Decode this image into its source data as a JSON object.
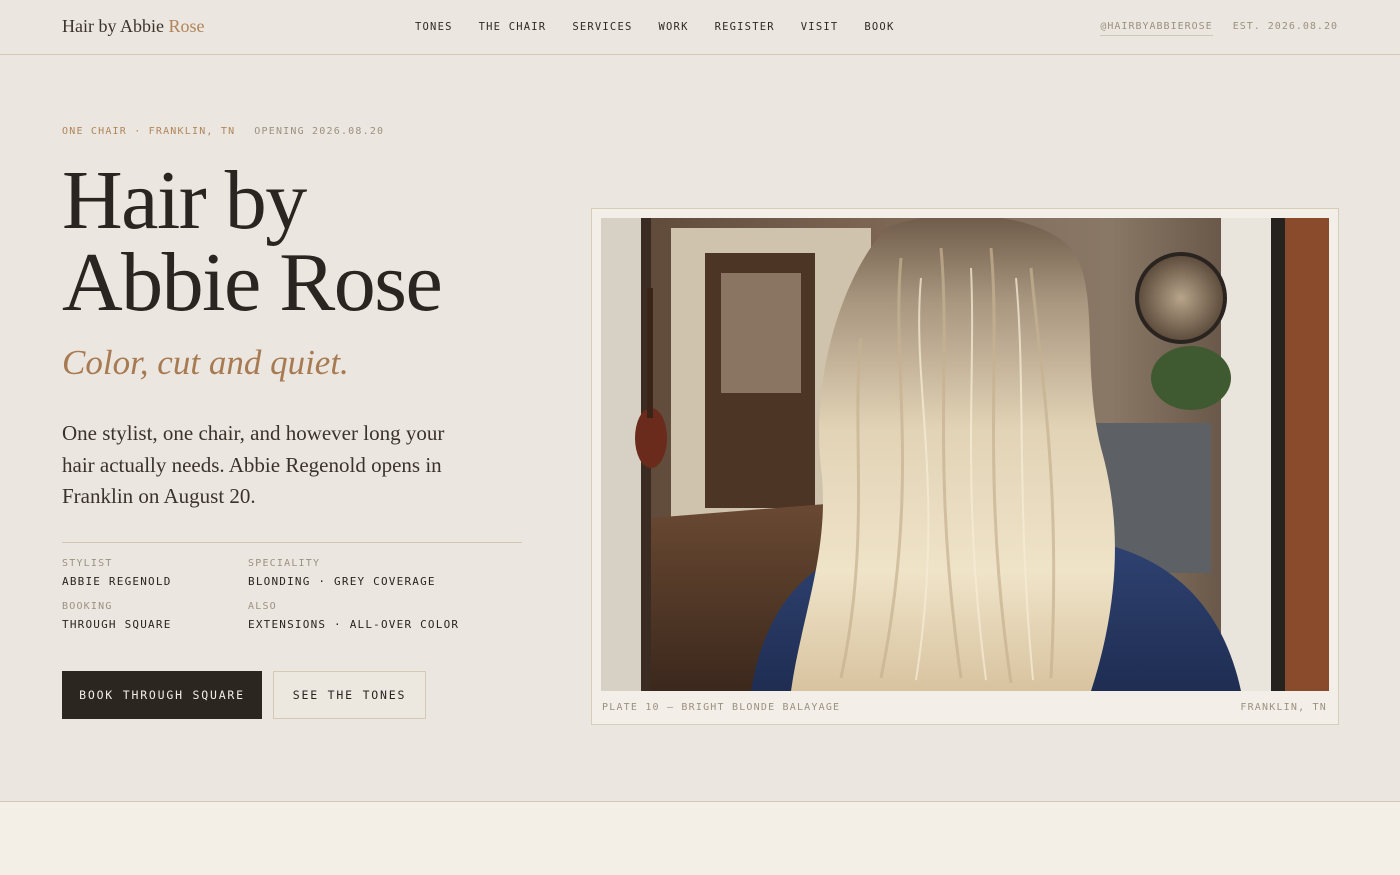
{
  "brand": {
    "name_main": "Hair by Abbie ",
    "name_accent": "Rose"
  },
  "nav": [
    "TONES",
    "THE CHAIR",
    "SERVICES",
    "WORK",
    "REGISTER",
    "VISIT",
    "BOOK"
  ],
  "header_right": {
    "handle": "@HAIRBYABBIEROSE",
    "est": "EST. 2026.08.20"
  },
  "hero": {
    "eyebrow_location": "ONE CHAIR · FRANKLIN, TN",
    "eyebrow_opening": "OPENING 2026.08.20",
    "title_line1": "Hair by",
    "title_line2": "Abbie Rose",
    "tagline": "Color, cut and quiet.",
    "lead": "One stylist, one chair, and however long your hair actually needs. Abbie Regenold opens in Franklin on August 20.",
    "facts": [
      {
        "label": "STYLIST",
        "value": "ABBIE REGENOLD"
      },
      {
        "label": "SPECIALITY",
        "value": "BLONDING · GREY COVERAGE"
      },
      {
        "label": "BOOKING",
        "value": "THROUGH SQUARE"
      },
      {
        "label": "ALSO",
        "value": "EXTENSIONS · ALL-OVER COLOR"
      }
    ],
    "cta_primary": "BOOK THROUGH SQUARE",
    "cta_secondary": "SEE THE TONES"
  },
  "plate": {
    "caption_left": "PLATE 10 — BRIGHT BLONDE BALAYAGE",
    "caption_right": "FRANKLIN, TN"
  },
  "colors": {
    "background": "#ebe6df",
    "ink": "#2a2520",
    "accent": "#b0855a",
    "muted": "#9a9180",
    "button_dark": "#2b2620"
  }
}
